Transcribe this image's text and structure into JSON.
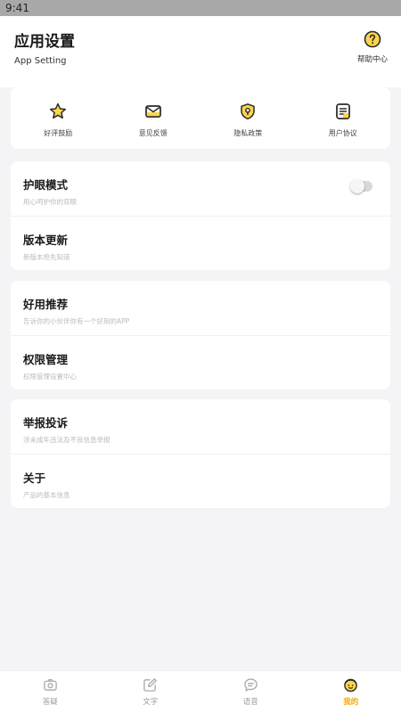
{
  "status_bar": {
    "time": "9:41"
  },
  "header": {
    "title": "应用设置",
    "subtitle": "App Setting",
    "help_label": "帮助中心"
  },
  "quick_actions": [
    {
      "label": "好评鼓励",
      "icon": "star-icon"
    },
    {
      "label": "意见反馈",
      "icon": "mail-icon"
    },
    {
      "label": "隐私政策",
      "icon": "shield-icon"
    },
    {
      "label": "用户协议",
      "icon": "document-icon"
    }
  ],
  "settings": {
    "eye_mode": {
      "title": "护眼模式",
      "subtitle": "用心呵护你的双眼",
      "enabled": false
    },
    "update": {
      "title": "版本更新",
      "subtitle": "新版本抢先知道"
    },
    "recommend": {
      "title": "好用推荐",
      "subtitle": "告诉你的小伙伴你有一个好用的APP"
    },
    "permissions": {
      "title": "权限管理",
      "subtitle": "权限管理设置中心"
    },
    "report": {
      "title": "举报投诉",
      "subtitle": "涉未成年违法及不良信息举报"
    },
    "about": {
      "title": "关于",
      "subtitle": "产品的基本信息"
    }
  },
  "tabbar": [
    {
      "label": "答疑",
      "icon": "camera-icon",
      "active": false
    },
    {
      "label": "文字",
      "icon": "edit-icon",
      "active": false
    },
    {
      "label": "语音",
      "icon": "chat-bubble-icon",
      "active": false
    },
    {
      "label": "我的",
      "icon": "face-icon",
      "active": true
    }
  ],
  "colors": {
    "accent": "#f5a800",
    "icon_fill": "#fcd64b",
    "icon_stroke": "#2a2a2a",
    "background": "#f4f4f6"
  }
}
